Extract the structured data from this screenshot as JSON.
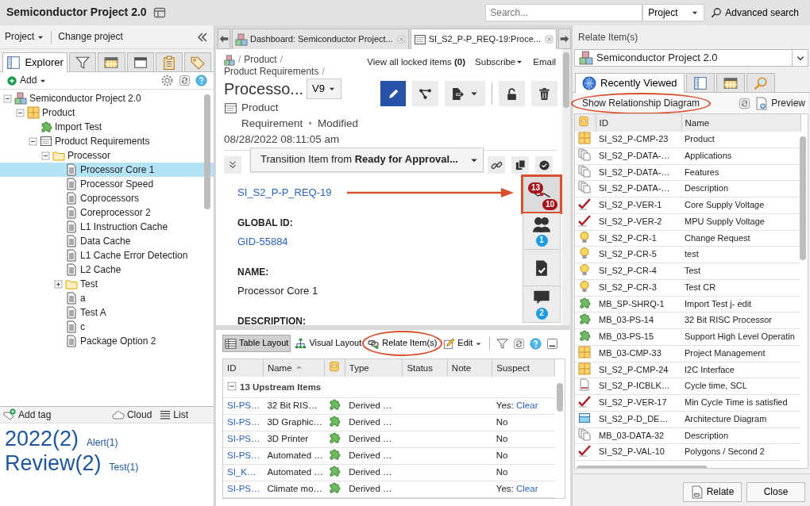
{
  "app_title": "Semiconductor Project 2.0",
  "search": {
    "placeholder": "Search...",
    "scope": "Project",
    "advanced": "Advanced search"
  },
  "left": {
    "project_menu": "Project",
    "change_project": "Change project",
    "tabs": [
      {
        "label": "Explorer",
        "kind": "explorer",
        "selected": true
      },
      {
        "kind": "filter",
        "selected": false
      },
      {
        "kind": "calendar",
        "selected": false
      },
      {
        "kind": "window",
        "selected": false
      },
      {
        "kind": "clipboard",
        "selected": false
      },
      {
        "kind": "tag",
        "selected": false
      }
    ],
    "add": "Add",
    "tree": [
      {
        "label": "Semiconductor Project 2.0",
        "kind": "project",
        "expanded": true,
        "selected": false,
        "children": [
          {
            "label": "Product",
            "kind": "component",
            "expanded": true,
            "selected": false,
            "children": [
              {
                "label": "Import Test",
                "kind": "requirement",
                "selected": false
              },
              {
                "label": "Product Requirements",
                "kind": "set",
                "expanded": true,
                "selected": false,
                "children": [
                  {
                    "label": "Processor",
                    "kind": "folder",
                    "expanded": true,
                    "selected": false,
                    "children": [
                      {
                        "label": "Processor Core 1",
                        "kind": "text",
                        "selected": true
                      },
                      {
                        "label": "Processor Speed",
                        "kind": "text",
                        "selected": false
                      },
                      {
                        "label": "Coprocessors",
                        "kind": "text",
                        "selected": false
                      },
                      {
                        "label": "Coreprocessor 2",
                        "kind": "text",
                        "selected": false
                      },
                      {
                        "label": "L1 Instruction Cache",
                        "kind": "text",
                        "selected": false
                      },
                      {
                        "label": "Data Cache",
                        "kind": "text",
                        "selected": false
                      },
                      {
                        "label": "L1 Cache Error Detection",
                        "kind": "text",
                        "selected": false
                      },
                      {
                        "label": "L2 Cache",
                        "kind": "text",
                        "selected": false
                      },
                      {
                        "label": "Test",
                        "kind": "folder",
                        "expanded": false,
                        "selected": false
                      },
                      {
                        "label": "a",
                        "kind": "text",
                        "selected": false
                      },
                      {
                        "label": "Test A",
                        "kind": "text",
                        "selected": false
                      },
                      {
                        "label": "c",
                        "kind": "text",
                        "selected": false
                      },
                      {
                        "label": "Package Option 2",
                        "kind": "text",
                        "selected": false
                      }
                    ]
                  }
                ]
              }
            ]
          }
        ]
      }
    ],
    "add_tag": "Add tag",
    "cloud": "Cloud",
    "list": "List",
    "tags": [
      {
        "label": "2022(2)",
        "kind": "large"
      },
      {
        "label": "Alert(1)",
        "kind": "small"
      },
      {
        "label": "Review(2)",
        "kind": "large"
      },
      {
        "label": "Test(1)",
        "kind": "small"
      }
    ]
  },
  "center": {
    "doc_tabs": [
      {
        "label": "Dashboard: Semiconductor Project...",
        "kind": "project",
        "selected": false
      },
      {
        "label": "SI_S2_P-P_REQ-19:Proce...",
        "kind": "set",
        "selected": true
      }
    ],
    "breadcrumb": [
      "Product",
      "Product Requirements"
    ],
    "crumb_separators": [
      "/",
      "/",
      "/"
    ],
    "meta_separator": "•",
    "locked": "View all locked items **(0)**",
    "subscribe": "Subscribe",
    "email": "Email",
    "title": "Processo...",
    "version": "V9",
    "item_type": "Product Requirement",
    "status": "Modified",
    "modified": "08/28/2022 08:11:05 am",
    "transition": "Transition Item from **Ready for Approval...**",
    "fields": [
      {
        "value": "SI_S2_P-P_REQ-19",
        "kind": "link"
      },
      {
        "label": "GLOBAL ID:",
        "value": "GID-55884",
        "kind": "link"
      },
      {
        "label": "NAME:",
        "value": "Processor Core 1",
        "kind": "text"
      },
      {
        "label": "DESCRIPTION:",
        "kind": "text"
      }
    ],
    "rail": [
      {
        "kind": "relations",
        "counts": [
          "13",
          "10"
        ],
        "selected": true
      },
      {
        "kind": "people",
        "count": "1",
        "selected": false
      },
      {
        "kind": "review",
        "selected": false
      },
      {
        "kind": "comment",
        "count": "2",
        "selected": false
      }
    ],
    "toolbar": [
      {
        "label": "Table Layout",
        "kind": "table",
        "selected": true
      },
      {
        "label": "Visual Layout",
        "kind": "hierarchy",
        "selected": false
      },
      {
        "label": "Relate Item(s)",
        "kind": "relate",
        "selected": false
      },
      {
        "label": "Edit",
        "kind": "edit",
        "selected": false
      }
    ],
    "table": {
      "columns": [
        {
          "label": "ID",
          "kind": "text"
        },
        {
          "label": "Name",
          "kind": "text",
          "sort_ascending": true
        },
        {
          "kind": "icon"
        },
        {
          "label": "Type",
          "kind": "text"
        },
        {
          "label": "Status",
          "kind": "text"
        },
        {
          "label": "Note",
          "kind": "text"
        },
        {
          "label": "Suspect",
          "kind": "text"
        }
      ],
      "group": {
        "label": "13 Upstream Items",
        "expanded": true
      },
      "rows": [
        {
          "id": "SI-PS…",
          "name": "32 Bit RIS…",
          "kind": "requirement",
          "type": "Derived …",
          "suspect": "Yes:",
          "clear": "Clear"
        },
        {
          "id": "SI-PS…",
          "name": "3D Graphic…",
          "kind": "requirement",
          "type": "Derived …",
          "suspect": "No"
        },
        {
          "id": "SI-PS…",
          "name": "3D Printer",
          "kind": "requirement",
          "type": "Derived …",
          "suspect": "No"
        },
        {
          "id": "SI-PS…",
          "name": "Automated …",
          "kind": "requirement",
          "type": "Derived …",
          "suspect": "No"
        },
        {
          "id": "SI_K…",
          "name": "Automated …",
          "kind": "requirement",
          "type": "Derived …",
          "suspect": "No"
        },
        {
          "id": "SI-PS…",
          "name": "Climate mo…",
          "kind": "requirement",
          "type": "Derived …",
          "suspect": "Yes:",
          "clear": "Clear"
        }
      ]
    }
  },
  "right": {
    "title": "Relate Item(s)",
    "project": "Semiconductor Project 2.0",
    "tabs": [
      {
        "label": "Recently Viewed",
        "kind": "globe",
        "selected": true
      },
      {
        "kind": "explorer",
        "selected": false
      },
      {
        "kind": "calendar",
        "selected": false
      },
      {
        "kind": "magnifier",
        "selected": false
      }
    ],
    "diagram": "Show Relationship Diagram",
    "preview": "Preview",
    "columns": [
      {
        "kind": "icon"
      },
      {
        "label": "ID",
        "kind": "text"
      },
      {
        "label": "Name",
        "kind": "text"
      }
    ],
    "rows": [
      {
        "kind": "component",
        "id": "SI_S2_P-CMP-23",
        "name": "Product"
      },
      {
        "kind": "data",
        "id": "SI_S2_P-DATA-…",
        "name": "Applications"
      },
      {
        "kind": "data",
        "id": "SI_S2_P-DATA-…",
        "name": "Features"
      },
      {
        "kind": "data",
        "id": "SI_S2_P-DATA-…",
        "name": "Description"
      },
      {
        "kind": "verification",
        "id": "SI_S2_P-VER-1",
        "name": "Core Supply Voltage"
      },
      {
        "kind": "verification",
        "id": "SI_S2_P-VER-2",
        "name": "MPU Supply Voltage"
      },
      {
        "kind": "change",
        "id": "SI_S2_P-CR-1",
        "name": "Change Request"
      },
      {
        "kind": "change",
        "id": "SI_S2_P-CR-5",
        "name": "test"
      },
      {
        "kind": "change",
        "id": "SI_S2_P-CR-4",
        "name": "Test"
      },
      {
        "kind": "change",
        "id": "SI_S2_P-CR-3",
        "name": "Test CR"
      },
      {
        "kind": "requirement",
        "id": "MB_SP-SHRQ-1",
        "name": "Import Test j- edit"
      },
      {
        "kind": "requirement",
        "id": "MB_03-PS-14",
        "name": "32 Bit RISC Processor"
      },
      {
        "kind": "requirement",
        "id": "MB_03-PS-15",
        "name": "Support High Level Operatin"
      },
      {
        "kind": "component",
        "id": "MB_03-CMP-33",
        "name": "Project Management"
      },
      {
        "kind": "component",
        "id": "SI_S2_P-CMP-24",
        "name": "I2C Interface"
      },
      {
        "kind": "block",
        "id": "SI_S2_P-ICBLK…",
        "name": "Cycle time, SCL"
      },
      {
        "kind": "verification",
        "id": "SI_S2_P-VER-17",
        "name": "Min Cycle Time is satisfied"
      },
      {
        "kind": "diagram",
        "id": "SI_S2_P-D_DE…",
        "name": "Architecture Diagram"
      },
      {
        "kind": "data",
        "id": "MB_03-DATA-32",
        "name": "Description"
      },
      {
        "kind": "verification",
        "id": "SI_S2_P-VAL-10",
        "name": "Polygons / Second 2"
      }
    ],
    "buttons": [
      "Relate",
      "Close"
    ]
  }
}
